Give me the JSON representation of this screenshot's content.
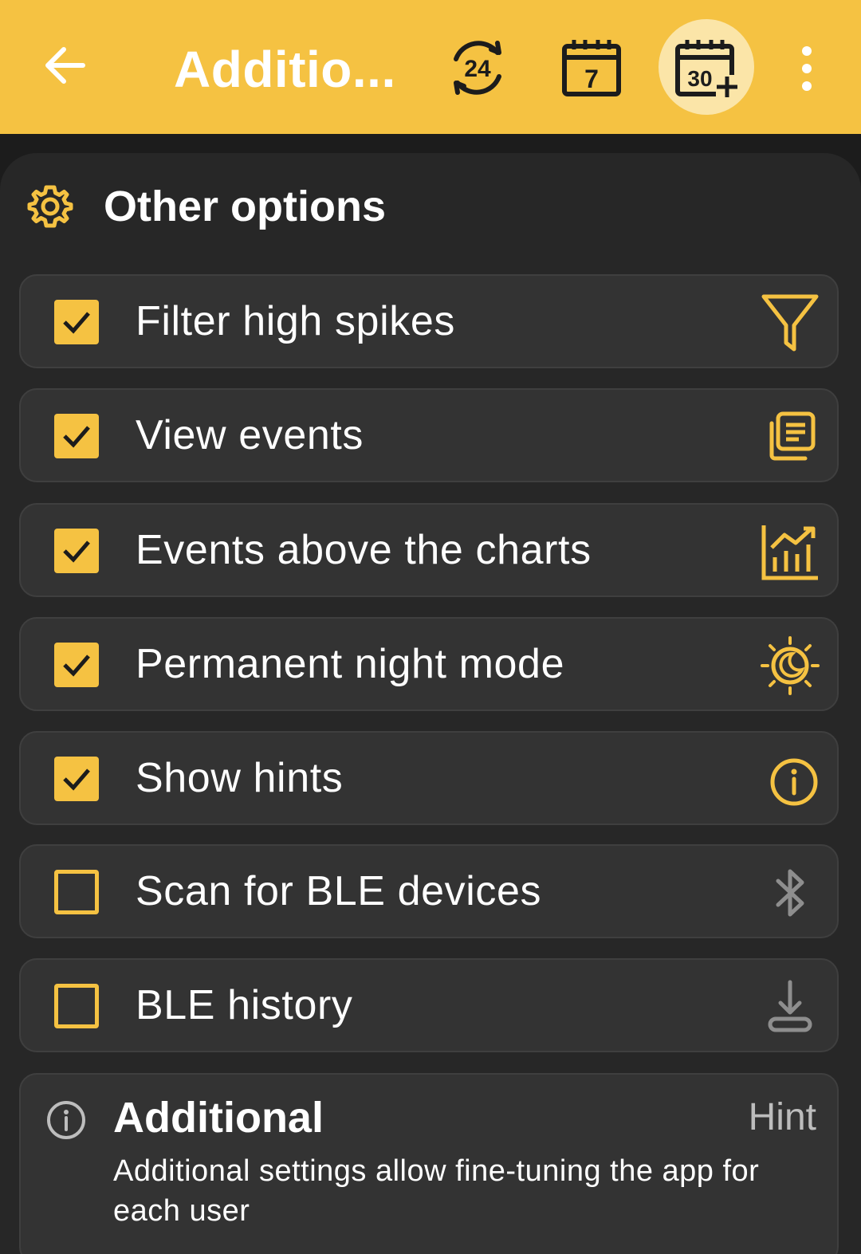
{
  "header": {
    "title": "Additio...",
    "icons": [
      "back-arrow-icon",
      "refresh-24-icon",
      "calendar-7-icon",
      "calendar-30-plus-icon",
      "more-vertical-icon"
    ],
    "badge_24": "24",
    "badge_7": "7",
    "badge_30": "30",
    "accent_color": "#f5c242"
  },
  "section": {
    "title": "Other options",
    "icon": "gear-icon"
  },
  "options": [
    {
      "label": "Filter high spikes",
      "checked": true,
      "icon": "filter-icon"
    },
    {
      "label": "View events",
      "checked": true,
      "icon": "events-list-icon"
    },
    {
      "label": "Events above the charts",
      "checked": true,
      "icon": "chart-growth-icon"
    },
    {
      "label": "Permanent night mode",
      "checked": true,
      "icon": "night-mode-icon"
    },
    {
      "label": "Show hints",
      "checked": true,
      "icon": "info-icon"
    },
    {
      "label": "Scan for BLE devices",
      "checked": false,
      "icon": "bluetooth-icon"
    },
    {
      "label": "BLE history",
      "checked": false,
      "icon": "download-icon"
    }
  ],
  "hint": {
    "title": "Additional",
    "tag": "Hint",
    "description": "Additional settings allow fine-tuning the app for each user",
    "icon": "info-icon"
  }
}
